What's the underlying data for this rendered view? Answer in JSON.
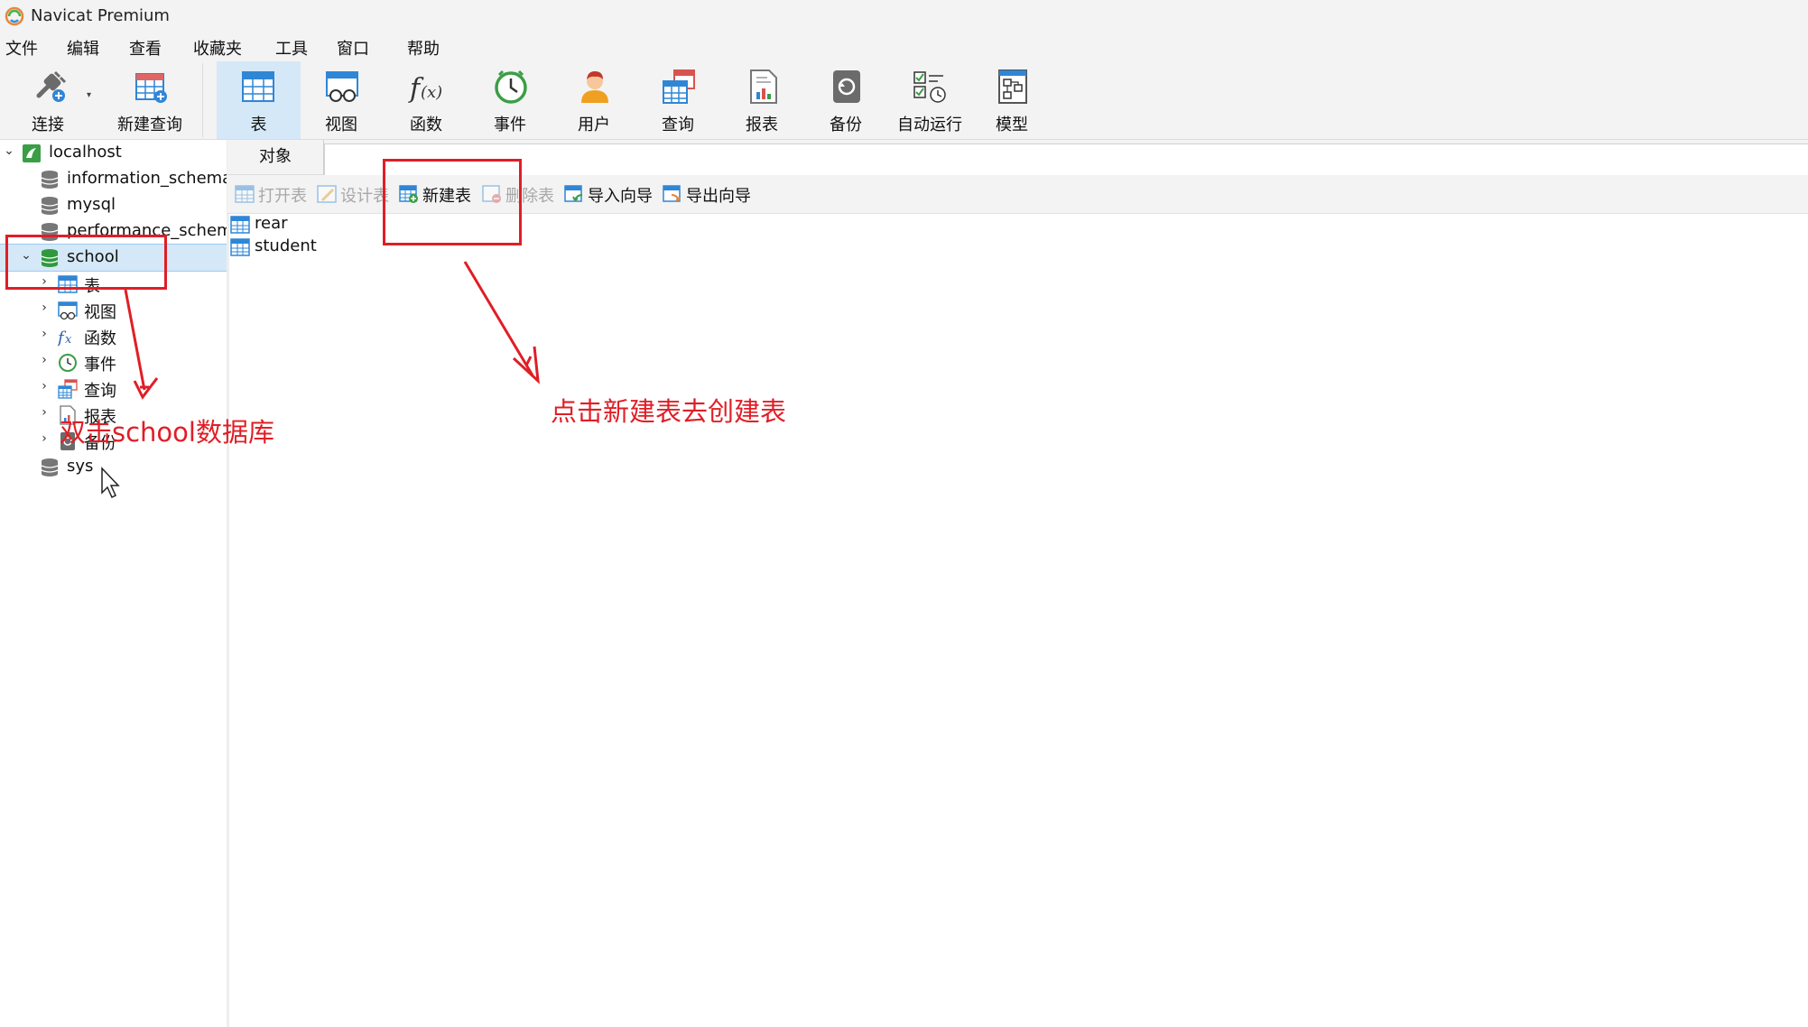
{
  "window": {
    "title": "Navicat Premium"
  },
  "menu": [
    "文件",
    "编辑",
    "查看",
    "收藏夹",
    "工具",
    "窗口",
    "帮助"
  ],
  "toolbar": {
    "connect": "连接",
    "new_query": "新建查询",
    "table": "表",
    "view": "视图",
    "function": "函数",
    "event": "事件",
    "user": "用户",
    "query": "查询",
    "report": "报表",
    "backup": "备份",
    "automation": "自动运行",
    "model": "模型"
  },
  "tree": {
    "connection": "localhost",
    "databases": [
      "information_schema",
      "mysql",
      "performance_schema"
    ],
    "school": {
      "name": "school",
      "children": [
        "表",
        "视图",
        "函数",
        "事件",
        "查询",
        "报表",
        "备份"
      ]
    },
    "sys": "sys"
  },
  "objects": {
    "tab_label": "对象",
    "actions": {
      "open": "打开表",
      "design": "设计表",
      "new": "新建表",
      "delete": "删除表",
      "import": "导入向导",
      "export": "导出向导"
    },
    "tables": [
      "rear",
      "student"
    ]
  },
  "annotations": {
    "school_note": "双击school数据库",
    "new_table_note": "点击新建表去创建表"
  },
  "colors": {
    "annotation": "#e01e26",
    "selection": "#d5e8f7",
    "toolbar_bg": "#f3f3f3"
  }
}
